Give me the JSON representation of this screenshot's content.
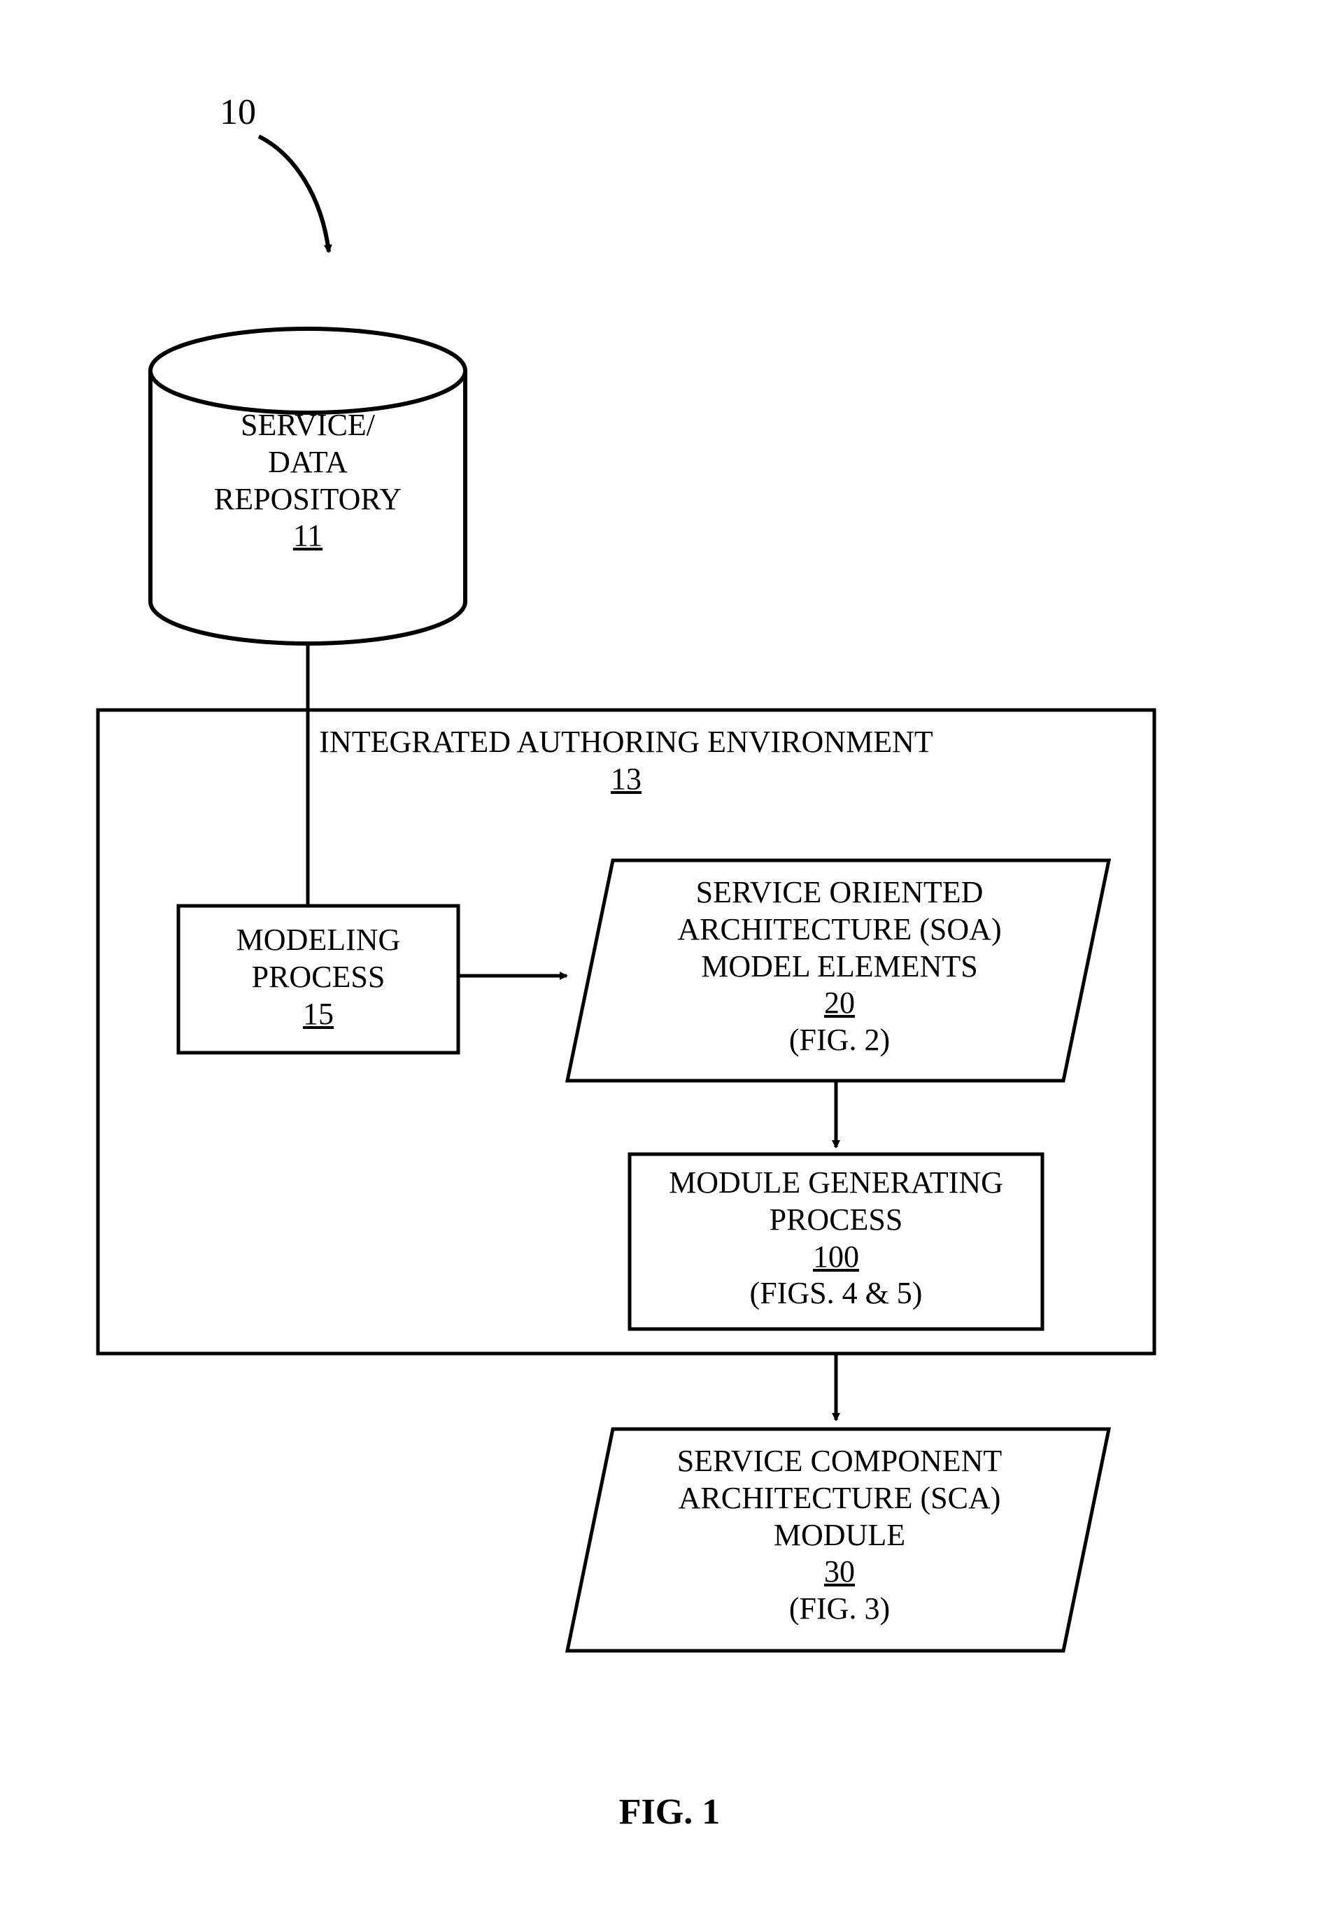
{
  "diagram": {
    "figure_label": "FIG. 1",
    "pointer_number": "10",
    "repository": {
      "line1": "SERVICE/",
      "line2": "DATA",
      "line3": "REPOSITORY",
      "ref": "11"
    },
    "env": {
      "title": "INTEGRATED AUTHORING ENVIRONMENT",
      "ref": "13"
    },
    "modeling": {
      "line1": "MODELING",
      "line2": "PROCESS",
      "ref": "15"
    },
    "soa": {
      "line1": "SERVICE ORIENTED",
      "line2": "ARCHITECTURE (SOA)",
      "line3": "MODEL ELEMENTS",
      "ref": "20",
      "note": "(FIG. 2)"
    },
    "modgen": {
      "line1": "MODULE GENERATING",
      "line2": "PROCESS",
      "ref": "100",
      "note": "(FIGS. 4 & 5)"
    },
    "sca": {
      "line1": "SERVICE COMPONENT",
      "line2": "ARCHITECTURE (SCA)",
      "line3": "MODULE",
      "ref": "30",
      "note": "(FIG. 3)"
    }
  }
}
